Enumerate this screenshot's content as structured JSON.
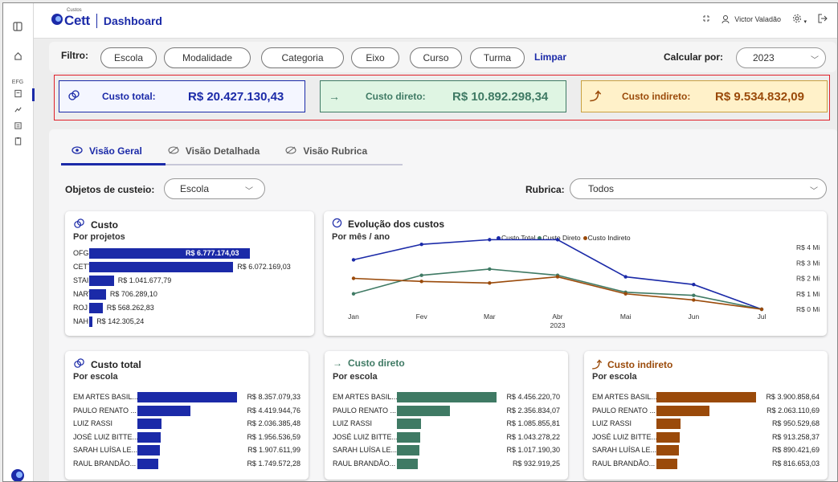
{
  "app": {
    "logo_small": "Custos",
    "logo": "Cett",
    "page_title": "Dashboard"
  },
  "user": {
    "name": "Victor Valadão"
  },
  "sidebar": {
    "items": [
      {
        "icon": "panel-toggle-icon"
      },
      {
        "icon": "home-icon"
      },
      {
        "icon": "ofg-label",
        "label": "EFG"
      },
      {
        "icon": "document-icon"
      },
      {
        "icon": "chart-icon"
      },
      {
        "icon": "list-icon"
      },
      {
        "icon": "clipboard-icon"
      }
    ]
  },
  "filters": {
    "label": "Filtro:",
    "pills": [
      "Escola",
      "Modalidade",
      "Categoria",
      "Eixo",
      "Curso",
      "Turma"
    ],
    "clear": "Limpar",
    "calc_label": "Calcular por:",
    "year": "2023"
  },
  "kpis": [
    {
      "label": "Custo total:",
      "value": "R$ 20.427.130,43",
      "color": "#1b2aa8"
    },
    {
      "label": "Custo direto:",
      "value": "R$ 10.892.298,34",
      "color": "#3f7a64"
    },
    {
      "label": "Custo indireto:",
      "value": "R$ 9.534.832,09",
      "color": "#9a4a0a"
    }
  ],
  "tabs": [
    {
      "label": "Visão Geral",
      "active": true
    },
    {
      "label": "Visão Detalhada",
      "active": false
    },
    {
      "label": "Visão Rubrica",
      "active": false
    }
  ],
  "objects": {
    "label": "Objetos de custeio:",
    "value": "Escola"
  },
  "rubrica": {
    "label": "Rubrica:",
    "value": "Todos"
  },
  "colors": {
    "total": "#1b2aa8",
    "direto": "#3f7a64",
    "indireto": "#9a4a0a"
  },
  "cards": {
    "custo": {
      "title": "Custo",
      "subtitle": "Por projetos"
    },
    "evolucao": {
      "title": "Evolução dos custos",
      "subtitle": "Por mês / ano"
    },
    "total": {
      "title": "Custo total",
      "subtitle": "Por escola"
    },
    "direto": {
      "title": "Custo direto",
      "subtitle": "Por escola"
    },
    "indireto": {
      "title": "Custo indireto",
      "subtitle": "Por escola"
    }
  },
  "chart_data": [
    {
      "type": "bar",
      "orientation": "horizontal",
      "categories": [
        "OFG",
        "CETT",
        "STAI",
        "NART",
        "ROJ",
        "NAH"
      ],
      "values": [
        6777174.03,
        6072169.03,
        1041677.79,
        706289.1,
        568262.83,
        142305.24
      ],
      "labels": [
        "R$ 6.777.174,03",
        "R$ 6.072.169,03",
        "R$ 1.041.677,79",
        "R$ 706.289,10",
        "R$ 568.262,83",
        "R$ 142.305,24"
      ],
      "color": "#1b2aa8"
    },
    {
      "type": "line",
      "categories": [
        "Jan",
        "Fev",
        "Mar",
        "Abr",
        "Mai",
        "Jun",
        "Jul"
      ],
      "x_year_label": "2023",
      "y_ticks": [
        "R$ 0 Mi",
        "R$ 1 Mi",
        "R$ 2 Mi",
        "R$ 3 Mi",
        "R$ 4 Mi"
      ],
      "ylim": [
        0,
        4
      ],
      "series": [
        {
          "name": "Custo Total",
          "color": "#1b2aa8",
          "values": [
            3.2,
            4.2,
            4.5,
            4.5,
            2.1,
            1.6,
            0
          ]
        },
        {
          "name": "Custo Direto",
          "color": "#3f7a64",
          "values": [
            1.0,
            2.2,
            2.6,
            2.2,
            1.1,
            0.9,
            0
          ]
        },
        {
          "name": "Custo Indireto",
          "color": "#9a4a0a",
          "values": [
            2.0,
            1.8,
            1.7,
            2.1,
            1.0,
            0.6,
            0
          ]
        }
      ]
    },
    {
      "type": "bar",
      "orientation": "horizontal",
      "categories": [
        "EM ARTES BASIL...",
        "PAULO RENATO ...",
        "LUIZ RASSI",
        "JOSÉ LUIZ BITTE...",
        "SARAH LUÍSA LE...",
        "RAUL BRANDÃO..."
      ],
      "values": [
        8357079.33,
        4419944.76,
        2036385.48,
        1956536.59,
        1907611.99,
        1749572.28
      ],
      "labels": [
        "R$ 8.357.079,33",
        "R$ 4.419.944,76",
        "R$ 2.036.385,48",
        "R$ 1.956.536,59",
        "R$ 1.907.611,99",
        "R$ 1.749.572,28"
      ],
      "color": "#1b2aa8"
    },
    {
      "type": "bar",
      "orientation": "horizontal",
      "categories": [
        "EM ARTES BASIL...",
        "PAULO RENATO ...",
        "LUIZ RASSI",
        "JOSÉ LUIZ BITTE...",
        "SARAH LUÍSA LE...",
        "RAUL BRANDÃO..."
      ],
      "values": [
        4456220.7,
        2356834.07,
        1085855.81,
        1043278.22,
        1017190.3,
        932919.25
      ],
      "labels": [
        "R$ 4.456.220,70",
        "R$ 2.356.834,07",
        "R$ 1.085.855,81",
        "R$ 1.043.278,22",
        "R$ 1.017.190,30",
        "R$ 932.919,25"
      ],
      "color": "#3f7a64"
    },
    {
      "type": "bar",
      "orientation": "horizontal",
      "categories": [
        "EM ARTES BASIL...",
        "PAULO RENATO ...",
        "LUIZ RASSI",
        "JOSÉ LUIZ BITTE...",
        "SARAH LUÍSA LE...",
        "RAUL BRANDÃO..."
      ],
      "values": [
        3900858.64,
        2063110.69,
        950529.68,
        913258.37,
        890421.69,
        816653.03
      ],
      "labels": [
        "R$ 3.900.858,64",
        "R$ 2.063.110,69",
        "R$ 950.529,68",
        "R$ 913.258,37",
        "R$ 890.421,69",
        "R$ 816.653,03"
      ],
      "color": "#9a4a0a"
    }
  ]
}
